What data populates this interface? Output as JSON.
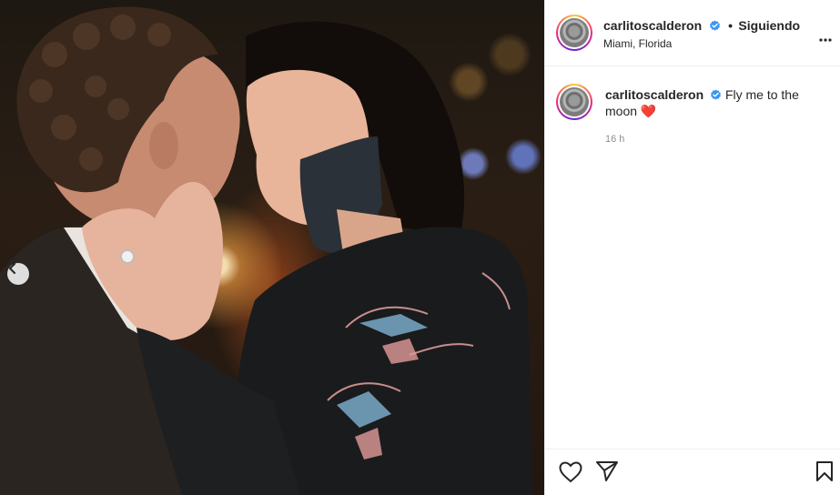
{
  "post": {
    "username": "carlitoscalderon",
    "separator": "•",
    "follow_status": "Siguiendo",
    "location": "Miami, Florida",
    "caption_text": "Fly me to the moon",
    "heart_emoji": "❤️",
    "time_ago": "16 h"
  },
  "icons": {
    "more": "more-options-icon",
    "verified": "verified-badge-icon",
    "like": "heart-icon",
    "share": "paper-plane-icon",
    "save": "bookmark-icon",
    "prev": "chevron-left-icon"
  },
  "colors": {
    "verified_blue": "#3897f0",
    "heart_red": "#d8232a",
    "muted_text": "#8e8e8e"
  }
}
